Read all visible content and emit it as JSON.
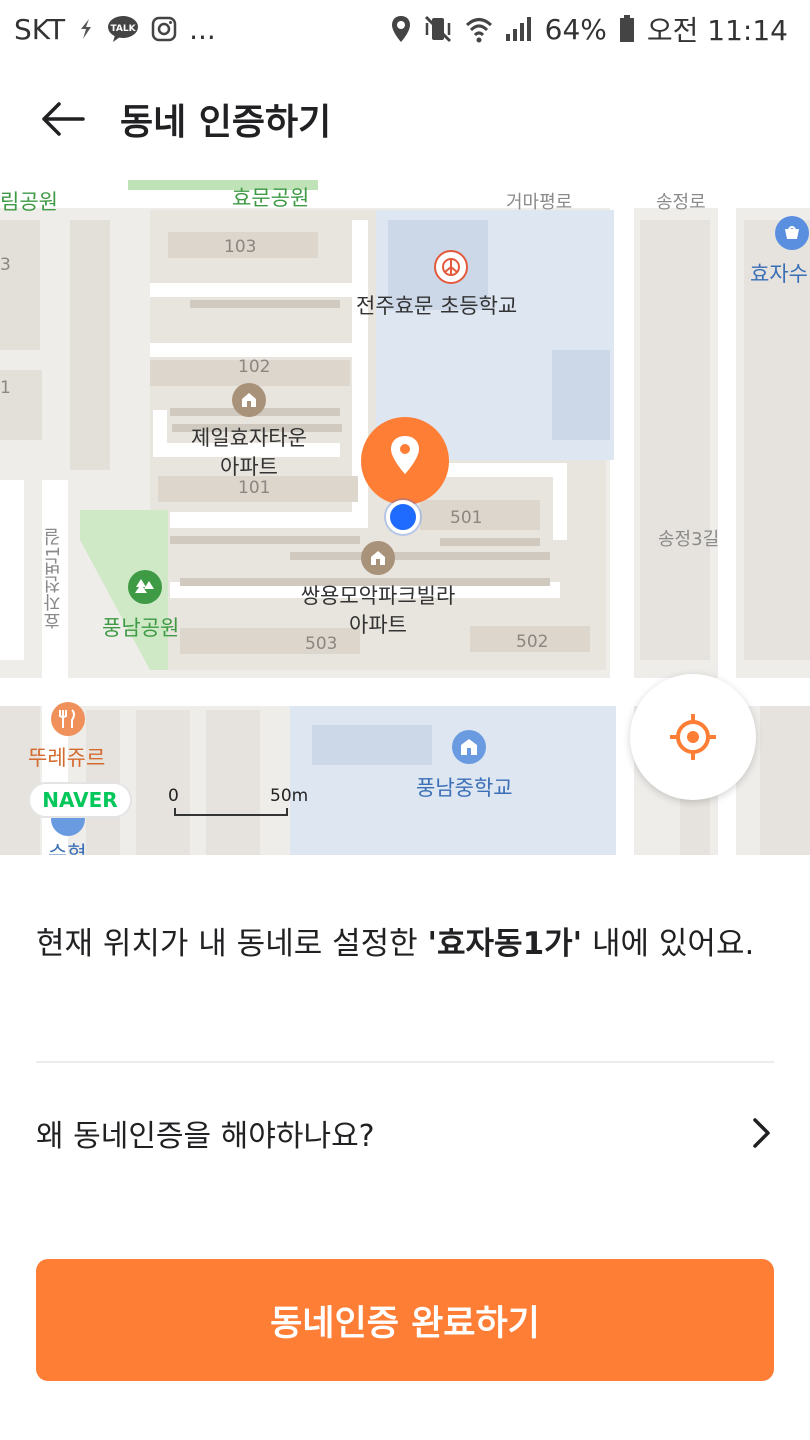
{
  "status_bar": {
    "carrier": "SKT",
    "extra": "...",
    "battery": "64%",
    "time": "오전 11:14"
  },
  "app_bar": {
    "title": "동네 인증하기",
    "back_icon": "arrow-left-icon"
  },
  "map": {
    "labels": {
      "park_left": "림공원",
      "park_top": "효문공원",
      "road_top": "거마평로",
      "road_right": "송정로",
      "road_right2": "송정3길",
      "road_left_vertical": "효자천변1길",
      "school_top": "전주효문 초등학교",
      "right_poi": "효자수",
      "apt1_line1": "제일효자타운",
      "apt1_line2": "아파트",
      "apt2_line1": "쌍용모악파크빌라",
      "apt2_line2": "아파트",
      "park_bottom": "풍남공원",
      "restaurant": "뚜레쥬르",
      "school_bottom": "풍남중학교",
      "bottom_cut": "수협",
      "bld_103": "103",
      "bld_102": "102",
      "bld_101": "101",
      "bld_501": "501",
      "bld_503": "503",
      "bld_502": "502",
      "left_num_a": "3",
      "left_num_b": "1"
    },
    "naver": "NAVER",
    "scale_start": "0",
    "scale_end": "50m"
  },
  "message": {
    "prefix": "현재 위치가 내 동네로 설정한 ",
    "neighborhood": "'효자동1가'",
    "suffix": " 내에 있어요."
  },
  "why": {
    "label": "왜 동네인증을 해야하나요?"
  },
  "submit": {
    "label": "동네인증 완료하기"
  },
  "colors": {
    "accent": "#ff7e36",
    "location_dot": "#1f6bff"
  }
}
